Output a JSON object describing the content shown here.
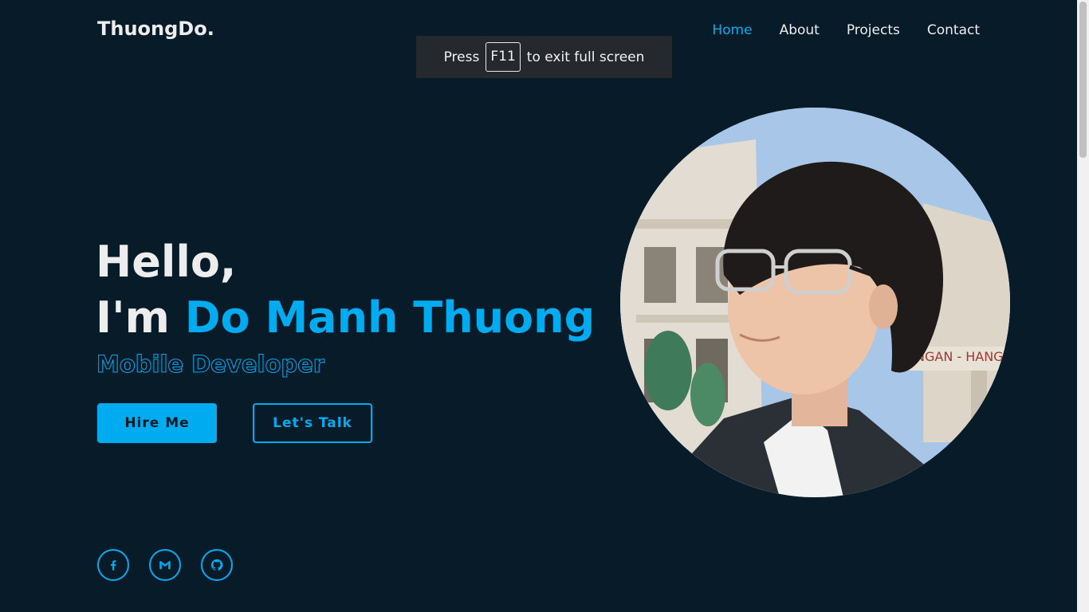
{
  "header": {
    "logo": "ThuongDo.",
    "nav": [
      {
        "label": "Home",
        "active": true
      },
      {
        "label": "About",
        "active": false
      },
      {
        "label": "Projects",
        "active": false
      },
      {
        "label": "Contact",
        "active": false
      }
    ]
  },
  "fullscreen_toast": {
    "prefix": "Press",
    "key": "F11",
    "suffix": "to exit full screen"
  },
  "hero": {
    "greeting": "Hello,",
    "intro": "I'm",
    "name": "Do Manh Thuong",
    "role": "Mobile Developer",
    "buttons": {
      "hire": "Hire Me",
      "talk": "Let's Talk"
    }
  },
  "socials": [
    {
      "icon": "facebook-icon"
    },
    {
      "icon": "gmail-icon"
    },
    {
      "icon": "github-icon"
    }
  ],
  "portrait": {
    "sign_text": "NGAN - HANG"
  },
  "colors": {
    "background": "#081b29",
    "accent": "#00abf0",
    "text": "#ededed"
  }
}
